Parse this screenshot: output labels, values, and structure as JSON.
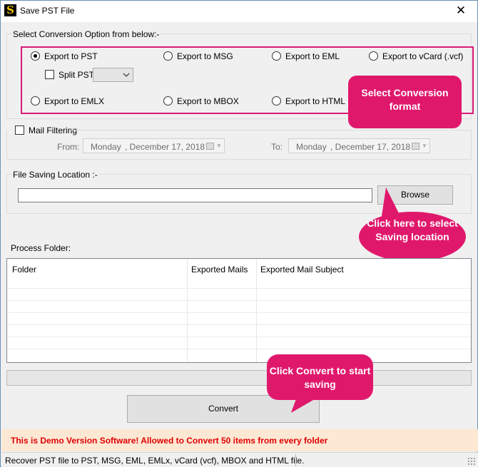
{
  "window": {
    "title": "Save PST File",
    "app_icon_letter": "S",
    "close_glyph": "✕"
  },
  "conversion": {
    "group_label": "Select Conversion Option from below:-",
    "options": [
      {
        "label": "Export to PST",
        "checked": true
      },
      {
        "label": "Export to MSG",
        "checked": false
      },
      {
        "label": "Export to EML",
        "checked": false
      },
      {
        "label": "Export to vCard (.vcf)",
        "checked": false
      },
      {
        "label": "Export to EMLX",
        "checked": false
      },
      {
        "label": "Export to MBOX",
        "checked": false
      },
      {
        "label": "Export to HTML",
        "checked": false
      }
    ],
    "split_pst_label": "Split PST",
    "split_pst_value": ""
  },
  "mail_filter": {
    "label": "Mail Filtering",
    "checked": false,
    "from_label": "From:",
    "from_day": "Monday",
    "from_date": ", December 17, 2018",
    "to_label": "To:",
    "to_day": "Monday",
    "to_date": ", December 17, 2018"
  },
  "saving": {
    "label": "File Saving Location :-",
    "path_value": "",
    "browse_label": "Browse"
  },
  "process": {
    "label": "Process Folder:",
    "columns": [
      "Folder",
      "Exported Mails",
      "Exported Mail Subject"
    ],
    "rows": []
  },
  "progress_value": 0,
  "convert_label": "Convert",
  "callouts": {
    "format": "Select Conversion format",
    "saving": "Click here to select Saving location",
    "convert": "Click Convert to start saving"
  },
  "demo_notice": "This is Demo Version Software! Allowed to Convert 50 items from every folder",
  "status_text": "Recover PST file to PST, MSG, EML, EMLx, vCard (vcf), MBOX and HTML file.",
  "colors": {
    "accent_pink": "#e0186c",
    "frame_pink": "#d81b75",
    "demo_text": "#e00000",
    "demo_bg": "#fde8d4"
  }
}
